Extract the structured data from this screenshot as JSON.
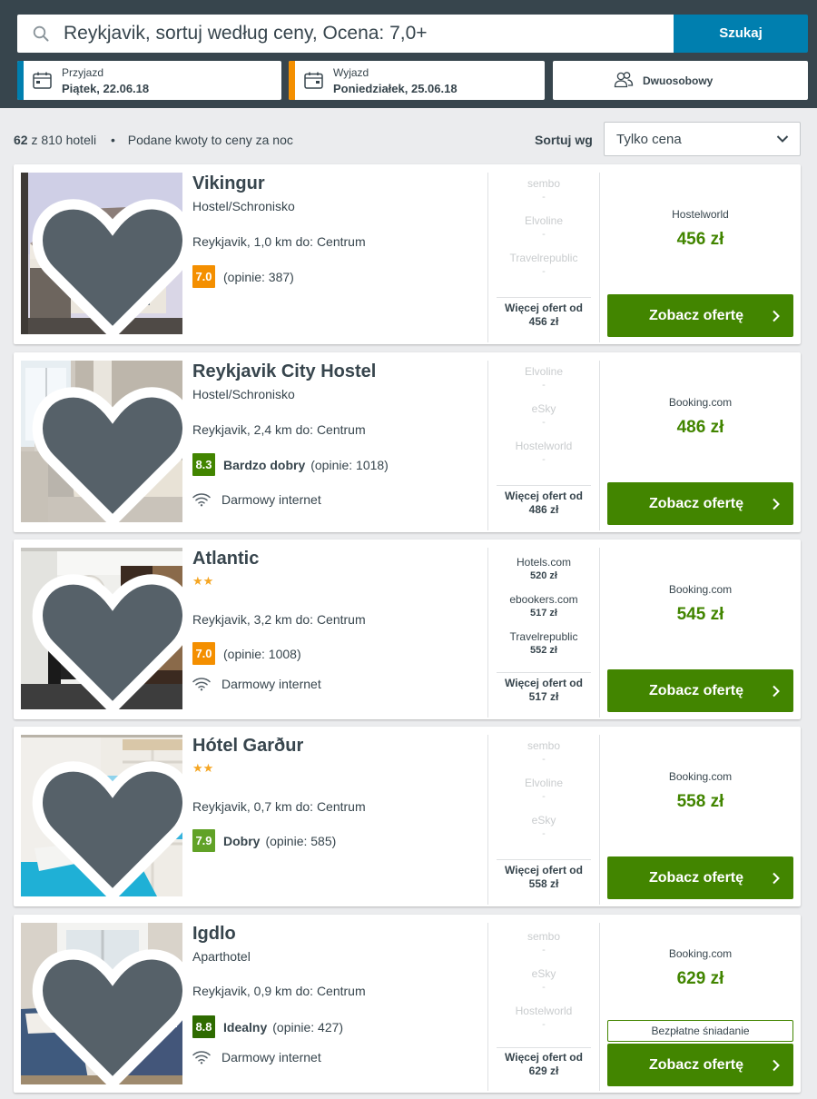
{
  "header": {
    "search_query": "Reykjavik, sortuj według ceny, Ocena: 7,0+",
    "search_button": "Szukaj",
    "checkin": {
      "label": "Przyjazd",
      "value": "Piątek, 22.06.18",
      "accent": "#007faf"
    },
    "checkout": {
      "label": "Wyjazd",
      "value": "Poniedziałek, 25.06.18",
      "accent": "#f48f00"
    },
    "room": "Dwuosobowy"
  },
  "toolbar": {
    "count_bold": "62",
    "count_rest": "z 810 hoteli",
    "separator": "•",
    "note": "Podane kwoty to ceny za noc",
    "sort_label": "Sortuj wg",
    "sort_value": "Tylko cena"
  },
  "colors": {
    "rating_orange": "#f48f00",
    "rating_green": "#428500",
    "rating_light_green": "#61a227",
    "price_green": "#428500",
    "button_green": "#428500"
  },
  "hotels": [
    {
      "name": "Vikingur",
      "type": "Hostel/Schronisko",
      "stars": "",
      "location": "Reykjavik, 1,0 km do: Centrum",
      "rating": "7.0",
      "rating_color": "#f48f00",
      "rating_word": "",
      "reviews": "(opinie: 387)",
      "amenity": "",
      "others": [
        {
          "name": "sembo",
          "price": "-"
        },
        {
          "name": "Elvoline",
          "price": "-"
        },
        {
          "name": "Travelrepublic",
          "price": "-"
        }
      ],
      "others_faded": true,
      "more_label": "Więcej ofert od",
      "more_price": "456 zł",
      "provider": "Hostelworld",
      "price": "456 zł",
      "perk": "",
      "button": "Zobacz ofertę"
    },
    {
      "name": "Reykjavik City Hostel",
      "type": "Hostel/Schronisko",
      "stars": "",
      "location": "Reykjavik, 2,4 km do: Centrum",
      "rating": "8.3",
      "rating_color": "#428500",
      "rating_word": "Bardzo dobry",
      "reviews": "(opinie: 1018)",
      "amenity": "Darmowy internet",
      "others": [
        {
          "name": "Elvoline",
          "price": "-"
        },
        {
          "name": "eSky",
          "price": "-"
        },
        {
          "name": "Hostelworld",
          "price": "-"
        }
      ],
      "others_faded": true,
      "more_label": "Więcej ofert od",
      "more_price": "486 zł",
      "provider": "Booking.com",
      "price": "486 zł",
      "perk": "",
      "button": "Zobacz ofertę"
    },
    {
      "name": "Atlantic",
      "type": "",
      "stars": "★★",
      "location": "Reykjavik, 3,2 km do: Centrum",
      "rating": "7.0",
      "rating_color": "#f48f00",
      "rating_word": "",
      "reviews": "(opinie: 1008)",
      "amenity": "Darmowy internet",
      "others": [
        {
          "name": "Hotels.com",
          "price": "520 zł"
        },
        {
          "name": "ebookers.com",
          "price": "517 zł"
        },
        {
          "name": "Travelrepublic",
          "price": "552 zł"
        }
      ],
      "others_faded": false,
      "more_label": "Więcej ofert od",
      "more_price": "517 zł",
      "provider": "Booking.com",
      "price": "545 zł",
      "perk": "",
      "button": "Zobacz ofertę"
    },
    {
      "name": "Hótel Garður",
      "type": "",
      "stars": "★★",
      "location": "Reykjavik, 0,7 km do: Centrum",
      "rating": "7.9",
      "rating_color": "#61a227",
      "rating_word": "Dobry",
      "reviews": "(opinie: 585)",
      "amenity": "",
      "others": [
        {
          "name": "sembo",
          "price": "-"
        },
        {
          "name": "Elvoline",
          "price": "-"
        },
        {
          "name": "eSky",
          "price": "-"
        }
      ],
      "others_faded": true,
      "more_label": "Więcej ofert od",
      "more_price": "558 zł",
      "provider": "Booking.com",
      "price": "558 zł",
      "perk": "",
      "button": "Zobacz ofertę"
    },
    {
      "name": "Igdlo",
      "type": "Aparthotel",
      "stars": "",
      "location": "Reykjavik, 0,9 km do: Centrum",
      "rating": "8.8",
      "rating_color": "#2e6b00",
      "rating_word": "Idealny",
      "reviews": "(opinie: 427)",
      "amenity": "Darmowy internet",
      "others": [
        {
          "name": "sembo",
          "price": "-"
        },
        {
          "name": "eSky",
          "price": "-"
        },
        {
          "name": "Hostelworld",
          "price": "-"
        }
      ],
      "others_faded": true,
      "more_label": "Więcej ofert od",
      "more_price": "629 zł",
      "provider": "Booking.com",
      "price": "629 zł",
      "perk": "Bezpłatne śniadanie",
      "button": "Zobacz ofertę"
    }
  ]
}
